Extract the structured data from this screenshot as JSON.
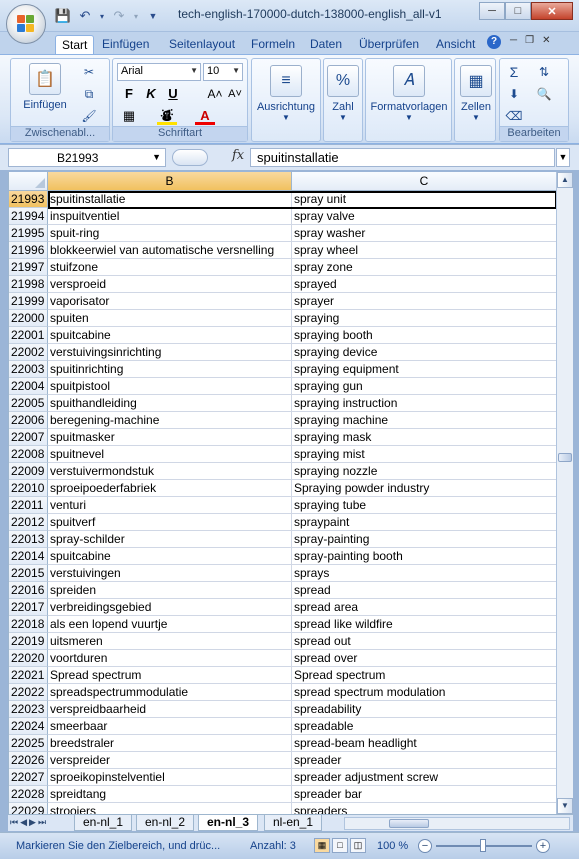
{
  "window": {
    "title": "tech-english-170000-dutch-138000-english_all-v1"
  },
  "ribbon_tabs": [
    "Start",
    "Einfügen",
    "Seitenlayout",
    "Formeln",
    "Daten",
    "Überprüfen",
    "Ansicht"
  ],
  "ribbon": {
    "paste_label": "Einfügen",
    "clipboard_group": "Zwischenabl...",
    "font_name": "Arial",
    "font_size": "10",
    "font_group": "Schriftart",
    "alignment_label": "Ausrichtung",
    "number_label": "Zahl",
    "number_icon": "%",
    "styles_label": "Formatvorlagen",
    "cells_label": "Zellen",
    "editing_group": "Bearbeiten",
    "bold": "F",
    "italic": "K",
    "underline": "U"
  },
  "formula_bar": {
    "name_box": "B21993",
    "fx": "fx",
    "value": "spuitinstallatie"
  },
  "columns": [
    "B",
    "C"
  ],
  "rows": [
    {
      "n": "21993",
      "b": "spuitinstallatie",
      "c": "spray unit"
    },
    {
      "n": "21994",
      "b": "inspuitventiel",
      "c": "spray valve"
    },
    {
      "n": "21995",
      "b": "spuit-ring",
      "c": "spray washer"
    },
    {
      "n": "21996",
      "b": "blokkeerwiel van automatische versnelling",
      "c": "spray wheel"
    },
    {
      "n": "21997",
      "b": "stuifzone",
      "c": "spray zone"
    },
    {
      "n": "21998",
      "b": "versproeid",
      "c": "sprayed"
    },
    {
      "n": "21999",
      "b": "vaporisator",
      "c": "sprayer"
    },
    {
      "n": "22000",
      "b": "spuiten",
      "c": "spraying"
    },
    {
      "n": "22001",
      "b": "spuitcabine",
      "c": "spraying booth"
    },
    {
      "n": "22002",
      "b": "verstuivingsinrichting",
      "c": "spraying device"
    },
    {
      "n": "22003",
      "b": "spuitinrichting",
      "c": "spraying equipment"
    },
    {
      "n": "22004",
      "b": "spuitpistool",
      "c": "spraying gun"
    },
    {
      "n": "22005",
      "b": "spuithandleiding",
      "c": "spraying instruction"
    },
    {
      "n": "22006",
      "b": "beregening-machine",
      "c": "spraying machine"
    },
    {
      "n": "22007",
      "b": "spuitmasker",
      "c": "spraying mask"
    },
    {
      "n": "22008",
      "b": "spuitnevel",
      "c": "spraying mist"
    },
    {
      "n": "22009",
      "b": "verstuivermondstuk",
      "c": "spraying nozzle"
    },
    {
      "n": "22010",
      "b": "sproeipoederfabriek",
      "c": "Spraying powder industry"
    },
    {
      "n": "22011",
      "b": "venturi",
      "c": "spraying tube"
    },
    {
      "n": "22012",
      "b": "spuitverf",
      "c": "spraypaint"
    },
    {
      "n": "22013",
      "b": "spray-schilder",
      "c": "spray-painting"
    },
    {
      "n": "22014",
      "b": "spuitcabine",
      "c": "spray-painting booth"
    },
    {
      "n": "22015",
      "b": "verstuivingen",
      "c": "sprays"
    },
    {
      "n": "22016",
      "b": "spreiden",
      "c": "spread"
    },
    {
      "n": "22017",
      "b": "verbreidingsgebied",
      "c": "spread area"
    },
    {
      "n": "22018",
      "b": "als een lopend vuurtje",
      "c": "spread like wildfire"
    },
    {
      "n": "22019",
      "b": "uitsmeren",
      "c": "spread out"
    },
    {
      "n": "22020",
      "b": "voortduren",
      "c": "spread over"
    },
    {
      "n": "22021",
      "b": "Spread spectrum",
      "c": "Spread spectrum"
    },
    {
      "n": "22022",
      "b": "spreadspectrummodulatie",
      "c": "spread spectrum modulation"
    },
    {
      "n": "22023",
      "b": "verspreidbaarheid",
      "c": "spreadability"
    },
    {
      "n": "22024",
      "b": "smeerbaar",
      "c": "spreadable"
    },
    {
      "n": "22025",
      "b": "breedstraler",
      "c": "spread-beam headlight"
    },
    {
      "n": "22026",
      "b": "verspreider",
      "c": "spreader"
    },
    {
      "n": "22027",
      "b": "sproeikopinstelventiel",
      "c": "spreader adjustment screw"
    },
    {
      "n": "22028",
      "b": "spreidtang",
      "c": "spreader bar"
    },
    {
      "n": "22029",
      "b": "strooiers",
      "c": "spreaders"
    }
  ],
  "sheet_tabs": [
    "en-nl_1",
    "en-nl_2",
    "en-nl_3",
    "nl-en_1"
  ],
  "status": {
    "message": "Markieren Sie den Zielbereich, und drüc...",
    "count": "Anzahl: 3",
    "zoom": "100 %"
  },
  "colors": {
    "selected_header": "#f1c15f",
    "ribbon_text": "#15428b",
    "grid_line": "#d0d7e5"
  }
}
